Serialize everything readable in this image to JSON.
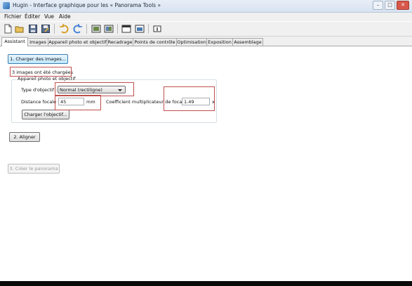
{
  "window": {
    "title": "Hugin - Interface graphique pour les « Panorama Tools »"
  },
  "menu": [
    "Fichier",
    "Éditer",
    "Vue",
    "Aide"
  ],
  "toolbar": {
    "icons": [
      "new-file-icon",
      "open-folder-icon",
      "save-icon",
      "save-as-icon",
      "undo-icon",
      "redo-icon",
      "control-points-icon",
      "optimize-icon",
      "preview-icon",
      "panorama-preview-icon",
      "info-icon"
    ]
  },
  "tabs": [
    "Assistant",
    "Images",
    "Appareil photo et objectif",
    "Recadrage",
    "Points de contrôle",
    "Optimisation",
    "Exposition",
    "Assemblage"
  ],
  "assistant": {
    "load_images_button": "1. Charger des images...",
    "images_loaded_status": "3 images ont été chargées",
    "lens_group": {
      "title": "Appareil photo et objectif",
      "lens_type_label": "Type d'objectif :",
      "lens_type_value": "Normal (rectiligne)",
      "focal_length_label": "Distance focale :",
      "focal_length_value": "45",
      "focal_length_unit": "mm",
      "crop_factor_label": "Coefficient multiplicateur de focale :",
      "crop_factor_value": "1.49",
      "crop_factor_unit": "x",
      "load_lens_button": "Charger l'objectif..."
    },
    "align_button": "2. Aligner",
    "create_panorama_button": "3. Créer le panorama"
  },
  "colors": {
    "highlight": "#c0504d",
    "primary_button": "#bee6fd"
  }
}
